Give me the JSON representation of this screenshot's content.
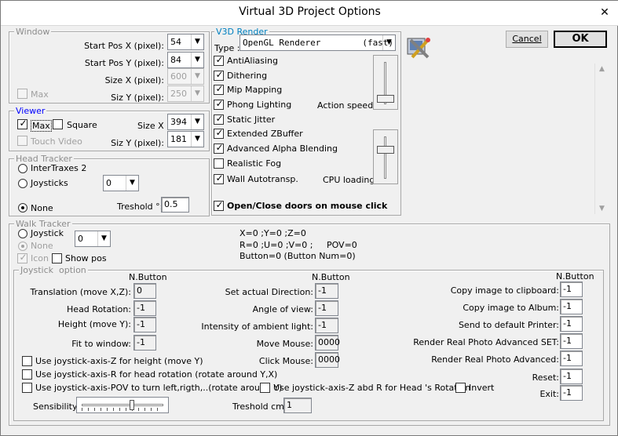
{
  "window": {
    "title": "Virtual 3D Project Options",
    "close_glyph": "✕"
  },
  "buttons": {
    "cancel": "Cancel",
    "ok": "OK"
  },
  "window_group": {
    "legend": "Window",
    "start_x_label": "Start Pos X (pixel):",
    "start_x": "54",
    "start_y_label": "Start Pos Y (pixel):",
    "start_y": "84",
    "size_x_label": "Size X (pixel):",
    "size_x": "600",
    "size_y_label": "Siz Y (pixel):",
    "size_y": "250",
    "max_label": "Max"
  },
  "viewer": {
    "legend": "Viewer",
    "max_label": "Max",
    "square_label": "Square",
    "touch_video_label": "Touch Video",
    "size_x_label": "Size X",
    "size_x": "394",
    "size_y_label": "Siz Y (pixel):",
    "size_y": "181"
  },
  "head_tracker": {
    "legend": "Head Tracker",
    "intertraxes_label": "InterTraxes 2",
    "joysticks_label": "Joysticks",
    "joysticks_value": "0",
    "none_label": "None",
    "treshold_label": "Treshold °:",
    "treshold_value": "0.5"
  },
  "render": {
    "legend": "V3D Render",
    "type_label": "Type :",
    "type_value": "OpenGL Renderer        (fast)",
    "antialiasing": "AntiAliasing",
    "dithering": "Dithering",
    "mip_mapping": "Mip Mapping",
    "phong_lighting": "Phong Lighting",
    "static_jitter": "Static Jitter",
    "extended_zbuffer": "Extended ZBuffer",
    "alpha_blending": "Advanced Alpha Blending",
    "realistic_fog": "Realistic Fog",
    "wall_autotransp": "Wall Autotransp.",
    "action_speed_label": "Action speed :",
    "cpu_loading_label": "CPU loading :",
    "open_doors": "Open/Close doors on mouse click"
  },
  "walk_tracker": {
    "legend": "Walk Tracker",
    "joystick_label": "Joystick",
    "joystick_value": "0",
    "none_label": "None",
    "icon_label": "Icon",
    "show_pos_label": "Show pos",
    "status_line1": "X=0 ;Y=0 ;Z=0",
    "status_line2": "R=0 ;U=0 ;V=0 ;     POV=0",
    "status_line3": "Button=0  (Button Num=0)"
  },
  "joystick_option": {
    "legend": "Joystick  option",
    "nbutton": "N.Button",
    "translation_label": "Translation (move X,Z):",
    "translation": "0",
    "head_rotation_label": "Head Rotation:",
    "head_rotation": "-1",
    "height_label": "Height (move Y):",
    "height": "-1",
    "fit_window_label": "Fit to window:",
    "fit_window": "-1",
    "set_direction_label": "Set actual Direction:",
    "set_direction": "-1",
    "angle_view_label": "Angle of view:",
    "angle_view": "-1",
    "ambient_label": "Intensity of ambient light:",
    "ambient": "-1",
    "move_mouse_label": "Move Mouse:",
    "move_mouse": "0000",
    "click_mouse_label": "Click Mouse:",
    "click_mouse": "0000",
    "copy_clipboard_label": "Copy image to clipboard:",
    "copy_clipboard": "-1",
    "copy_album_label": "Copy image to Album:",
    "copy_album": "-1",
    "send_printer_label": "Send to default Printer:",
    "send_printer": "-1",
    "render_adv_set_label": "Render Real Photo Advanced SET:",
    "render_adv_set": "-1",
    "render_adv_label": "Render Real Photo Advanced:",
    "render_adv": "-1",
    "reset_label": "Reset:",
    "reset": "-1",
    "exit_label": "Exit:",
    "exit": "-1",
    "axis_z_height": "Use joystick-axis-Z for height (move Y)",
    "axis_r_head": "Use joystick-axis-R for head rotation (rotate around Y,X)",
    "axis_pov": "Use joystick-axis-POV to turn left,rigth,..(rotate around Y)",
    "axis_zr_head": "Use joystick-axis-Z abd R for Head 's Rotation",
    "invert_label": "Invert",
    "sensibility_label": "Sensibility :",
    "treshold_cm_label": "Treshold cm:",
    "treshold_cm": "1"
  },
  "icons": {
    "logo": "tools-logo-icon"
  },
  "colors": {
    "legend_blue": "#0000ff",
    "legend_gray": "#8c8c8c"
  }
}
